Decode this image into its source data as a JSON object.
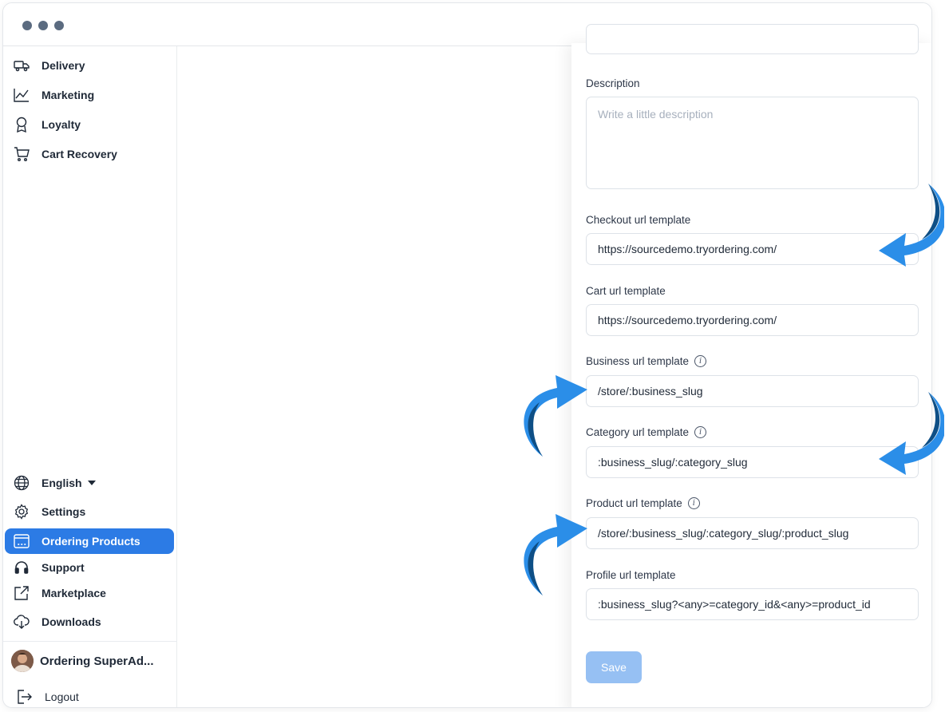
{
  "sidebar": {
    "top_items": [
      {
        "label": "Delivery",
        "icon": "truck-icon"
      },
      {
        "label": "Marketing",
        "icon": "chart-line-icon"
      },
      {
        "label": "Loyalty",
        "icon": "award-icon"
      },
      {
        "label": "Cart Recovery",
        "icon": "cart-icon"
      }
    ],
    "bottom_items": [
      {
        "label": "English",
        "icon": "globe-icon"
      },
      {
        "label": "Settings",
        "icon": "gear-icon"
      },
      {
        "label": "Ordering Products",
        "icon": "window-icon",
        "active": true
      },
      {
        "label": "Support",
        "icon": "headset-icon"
      },
      {
        "label": "Marketplace",
        "icon": "external-link-icon"
      },
      {
        "label": "Downloads",
        "icon": "cloud-download-icon"
      }
    ],
    "user_name": "Ordering SuperAd...",
    "logout_label": "Logout"
  },
  "form": {
    "description": {
      "label": "Description",
      "placeholder": "Write a little description"
    },
    "checkout_url": {
      "label": "Checkout url template",
      "value": "https://sourcedemo.tryordering.com/"
    },
    "cart_url": {
      "label": "Cart url template",
      "value": "https://sourcedemo.tryordering.com/"
    },
    "business_url": {
      "label": "Business url template",
      "value": "/store/:business_slug"
    },
    "category_url": {
      "label": "Category url template",
      "value": ":business_slug/:category_slug"
    },
    "product_url": {
      "label": "Product url template",
      "value": "/store/:business_slug/:category_slug/:product_slug"
    },
    "profile_url": {
      "label": "Profile url template",
      "value": ":business_slug?<any>=category_id&<any>=product_id"
    },
    "save_label": "Save",
    "info_glyph": "i"
  },
  "colors": {
    "accent": "#2c7be5",
    "save_disabled": "#96c0f3",
    "arrow_light": "#2b8ee8",
    "arrow_dark": "#0e4f86"
  }
}
